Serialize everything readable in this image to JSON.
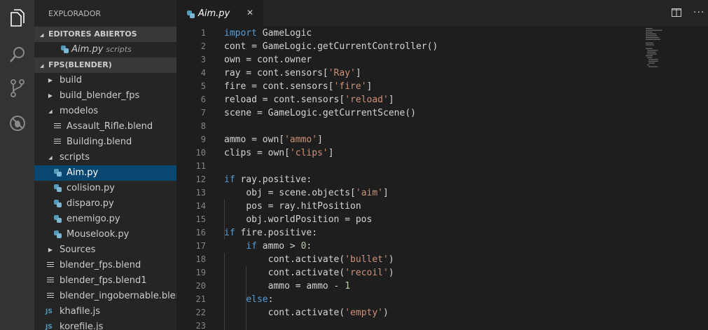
{
  "activity_bar": {
    "icons": [
      "files-icon",
      "search-icon",
      "source-control-icon",
      "debug-icon"
    ]
  },
  "sidebar": {
    "title": "EXPLORADOR",
    "open_editors": {
      "label": "EDITORES ABIERTOS",
      "items": [
        {
          "name": "Aim.py",
          "hint": "scripts"
        }
      ]
    },
    "project": {
      "label": "FPS(BLENDER)",
      "items": [
        {
          "label": "build",
          "type": "folder",
          "state": "collapsed"
        },
        {
          "label": "build_blender_fps",
          "type": "folder",
          "state": "collapsed"
        },
        {
          "label": "modelos",
          "type": "folder",
          "state": "expanded"
        },
        {
          "label": "Assault_Rifle.blend",
          "type": "blend"
        },
        {
          "label": "Building.blend",
          "type": "blend"
        },
        {
          "label": "scripts",
          "type": "folder",
          "state": "expanded"
        },
        {
          "label": "Aim.py",
          "type": "py",
          "selected": true
        },
        {
          "label": "colision.py",
          "type": "py"
        },
        {
          "label": "disparo.py",
          "type": "py"
        },
        {
          "label": "enemigo.py",
          "type": "py"
        },
        {
          "label": "Mouselook.py",
          "type": "py"
        },
        {
          "label": "Sources",
          "type": "folder",
          "state": "collapsed"
        },
        {
          "label": "blender_fps.blend",
          "type": "blend"
        },
        {
          "label": "blender_fps.blend1",
          "type": "blend"
        },
        {
          "label": "blender_ingobernable.blend",
          "type": "blend"
        },
        {
          "label": "khafile.js",
          "type": "js"
        },
        {
          "label": "korefile.js",
          "type": "js"
        }
      ]
    }
  },
  "editor": {
    "tab": {
      "name": "Aim.py",
      "close": "✕"
    },
    "line_numbers": [
      "1",
      "2",
      "3",
      "4",
      "5",
      "6",
      "7",
      "8",
      "9",
      "10",
      "11",
      "12",
      "13",
      "14",
      "15",
      "16",
      "17",
      "18",
      "19",
      "20",
      "21",
      "22",
      "23"
    ],
    "code_lines": [
      "import GameLogic",
      "cont = GameLogic.getCurrentController()",
      "own = cont.owner",
      "ray = cont.sensors['Ray']",
      "fire = cont.sensors['fire']",
      "reload = cont.sensors['reload']",
      "scene = GameLogic.getCurrentScene()",
      "",
      "ammo = own['ammo']",
      "clips = own['clips']",
      "",
      "if ray.positive:",
      "    obj = scene.objects['aim']",
      "    pos = ray.hitPosition",
      "    obj.worldPosition = pos",
      "if fire.positive:",
      "    if ammo > 0:",
      "        cont.activate('bullet')",
      "        cont.activate('recoil')",
      "        ammo = ammo - 1",
      "    else:",
      "        cont.activate('empty')",
      ""
    ]
  },
  "toolbar": {
    "icons": [
      "split-editor-icon",
      "more-actions-icon"
    ]
  }
}
